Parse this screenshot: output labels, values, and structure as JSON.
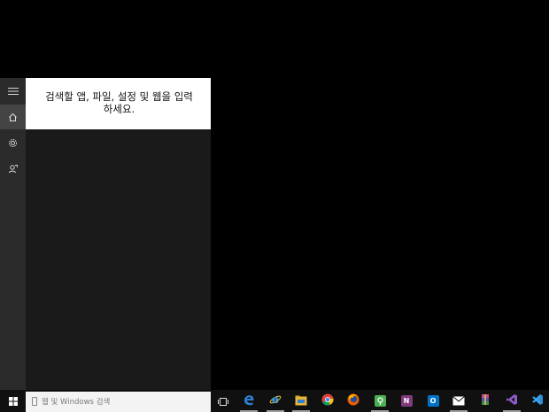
{
  "start_panel": {
    "prompt_text": "검색할 앱, 파일, 설정 및 웹을 입력하세요.",
    "rail_icons": [
      "hamburger-menu-icon",
      "home-icon",
      "settings-gear-icon",
      "feedback-icon"
    ]
  },
  "taskbar": {
    "search_placeholder": "웹 및 Windows 검색",
    "colors": {
      "taskbar_bg": "#101010",
      "panel_bg": "#1a1a1a",
      "rail_bg": "#2b2b2b",
      "selected_rail_bg": "#444444"
    },
    "apps": [
      {
        "name": "task-view-icon"
      },
      {
        "name": "edge-icon"
      },
      {
        "name": "internet-explorer-icon"
      },
      {
        "name": "file-explorer-icon"
      },
      {
        "name": "chrome-icon"
      },
      {
        "name": "firefox-icon"
      },
      {
        "name": "sourcetree-icon"
      },
      {
        "name": "onenote-icon"
      },
      {
        "name": "outlook-icon"
      },
      {
        "name": "mail-icon"
      },
      {
        "name": "winrar-icon"
      },
      {
        "name": "visual-studio-icon"
      },
      {
        "name": "visual-studio-code-icon"
      }
    ]
  }
}
